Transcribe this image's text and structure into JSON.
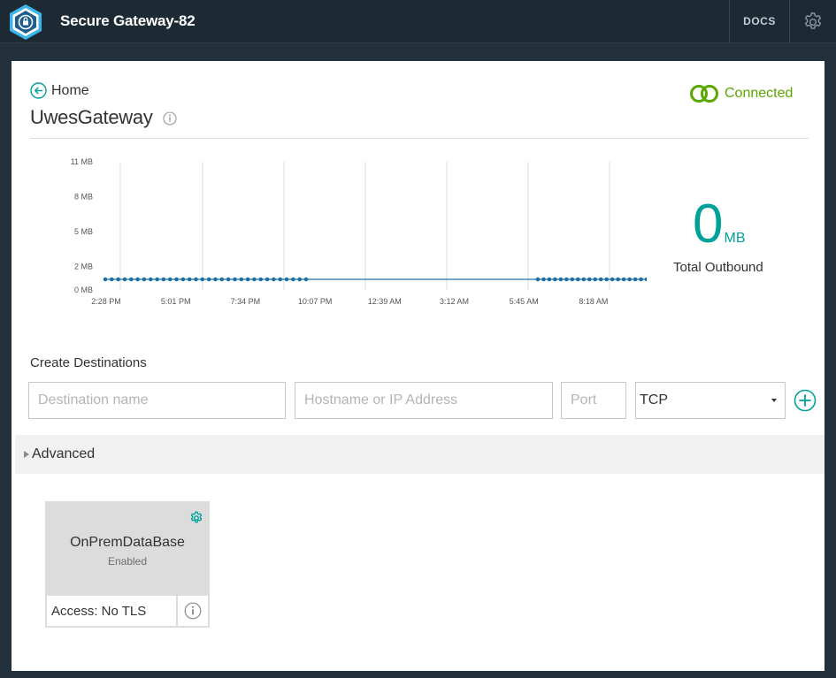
{
  "header": {
    "title": "Secure Gateway-82",
    "docs_label": "DOCS",
    "logo_icon": "secure-gateway-shield-icon",
    "settings_icon": "gear-icon"
  },
  "nav": {
    "home_label": "Home",
    "back_icon": "arrow-left-circle-icon"
  },
  "gateway": {
    "name": "UwesGateway",
    "info_icon": "info-icon",
    "status_label": "Connected",
    "status_icon": "connected-rings-icon",
    "status_color": "#5aa700"
  },
  "traffic": {
    "total_value": "0",
    "total_unit": "MB",
    "total_label": "Total Outbound",
    "accent_color": "#00a19a"
  },
  "chart_data": {
    "type": "line",
    "title": "",
    "xlabel": "",
    "ylabel": "",
    "y_tick_labels": [
      "11 MB",
      "8 MB",
      "5 MB",
      "2 MB",
      "0 MB"
    ],
    "y_ticks": [
      11,
      8,
      5,
      2,
      0
    ],
    "ylim": [
      0,
      11
    ],
    "x_tick_labels": [
      "2:28 PM",
      "5:01 PM",
      "7:34 PM",
      "10:07 PM",
      "12:39 AM",
      "3:12 AM",
      "5:45 AM",
      "8:18 AM"
    ],
    "grid": true,
    "series_color": "#1d6fa5",
    "series": [
      {
        "name": "",
        "segments": [
          {
            "points": 32,
            "value": 0
          },
          {
            "points": 20,
            "value": 0
          }
        ]
      }
    ]
  },
  "create": {
    "heading": "Create Destinations",
    "name_placeholder": "Destination name",
    "host_placeholder": "Hostname or IP Address",
    "port_placeholder": "Port",
    "protocol_value": "TCP",
    "add_icon": "plus-circle-icon"
  },
  "advanced": {
    "label": "Advanced"
  },
  "destinations": [
    {
      "name": "OnPremDataBase",
      "state": "Enabled",
      "access": "Access: No TLS",
      "gear_icon": "gear-icon",
      "info_icon": "info-icon"
    }
  ]
}
